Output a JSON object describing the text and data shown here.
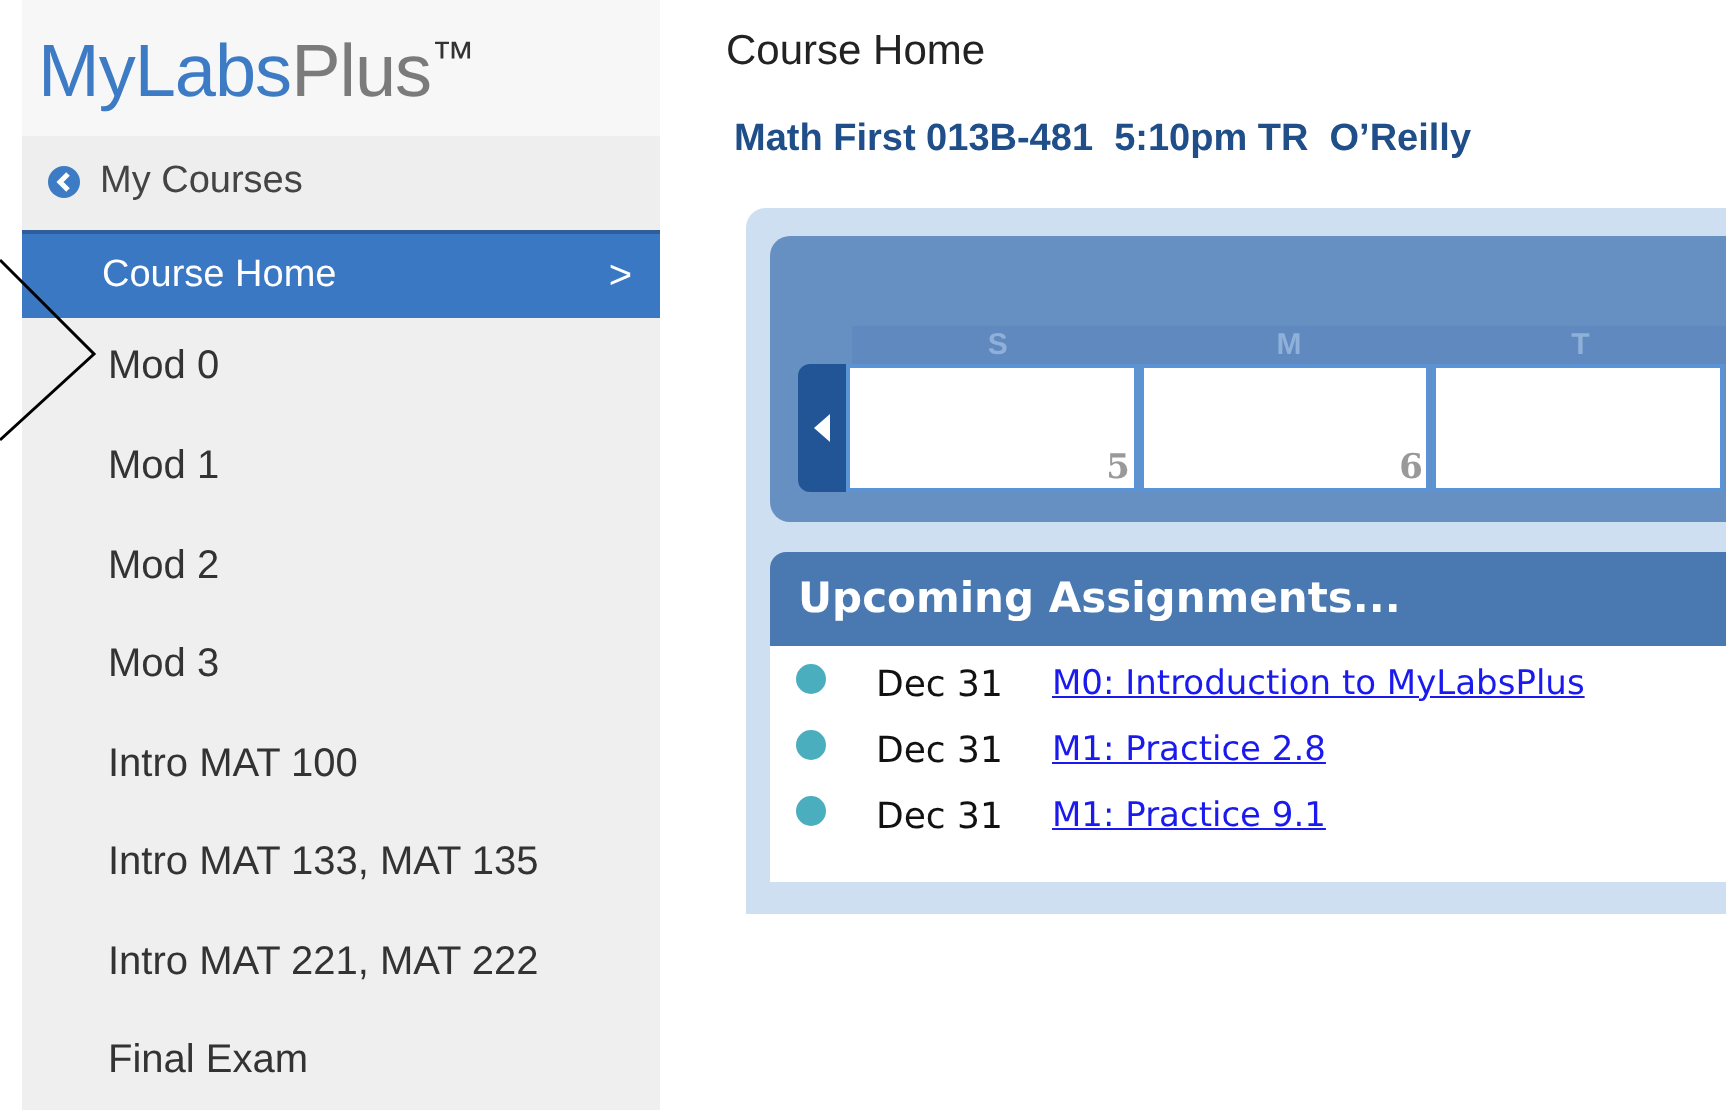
{
  "logo": [
    "MyLabs",
    "Plus",
    "™"
  ],
  "back_link": {
    "label": "My Courses"
  },
  "sidebar": {
    "items": [
      {
        "label": "Course Home",
        "selected": true,
        "chevron": ">"
      },
      {
        "label": "Mod 0",
        "selected": false
      },
      {
        "label": "Mod 1",
        "selected": false
      },
      {
        "label": "Mod 2",
        "selected": false
      },
      {
        "label": "Mod 3",
        "selected": false
      },
      {
        "label": "Intro MAT 100",
        "selected": false
      },
      {
        "label": "Intro MAT 133, MAT 135",
        "selected": false
      },
      {
        "label": "Intro MAT 221, MAT 222",
        "selected": false
      },
      {
        "label": "Final Exam",
        "selected": false
      }
    ]
  },
  "page_title": "Course Home",
  "course_title": "Math First 013B-481  5:10pm TR  O’Reilly",
  "calendar": {
    "days": [
      {
        "label": "S",
        "date": "5"
      },
      {
        "label": "M",
        "date": "6"
      },
      {
        "label": "T"
      }
    ]
  },
  "upcoming": {
    "title": "Upcoming Assignments...",
    "items": [
      {
        "date": "Dec 31",
        "link": "M0: Introduction to MyLabsPlus",
        "color": "#4aaebf"
      },
      {
        "date": "Dec 31",
        "link": "M1: Practice 2.8",
        "color": "#4aaebf"
      },
      {
        "date": "Dec 31",
        "link": "M1: Practice 9.1",
        "color": "#4aaebf"
      }
    ]
  }
}
